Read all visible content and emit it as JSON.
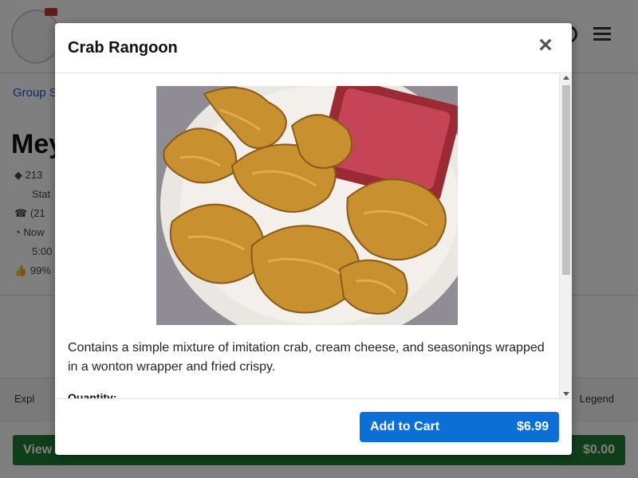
{
  "background": {
    "breadcrumb": "Group S",
    "restaurant_title": "Mey",
    "info_lines": [
      "213",
      "Stat",
      "(21",
      "Now",
      "5:00",
      "99%"
    ],
    "footer_left": "Expl",
    "footer_right": "Legend",
    "view_cart_label": "View",
    "view_cart_amount": "$0.00"
  },
  "modal": {
    "title": "Crab Rangoon",
    "close_icon": "×",
    "image_alt": "Crab Rangoon",
    "description": "Contains a simple mixture of imitation crab, cream cheese, and seasonings wrapped in a wonton wrapper and fried crispy.",
    "quantity_label": "Quantity:",
    "add_to_cart_label": "Add to Cart",
    "price": "$6.99"
  },
  "colors": {
    "primary": "#0b6fd6",
    "success": "#1e7e34",
    "overlay": "rgba(0,0,0,0.5)"
  }
}
